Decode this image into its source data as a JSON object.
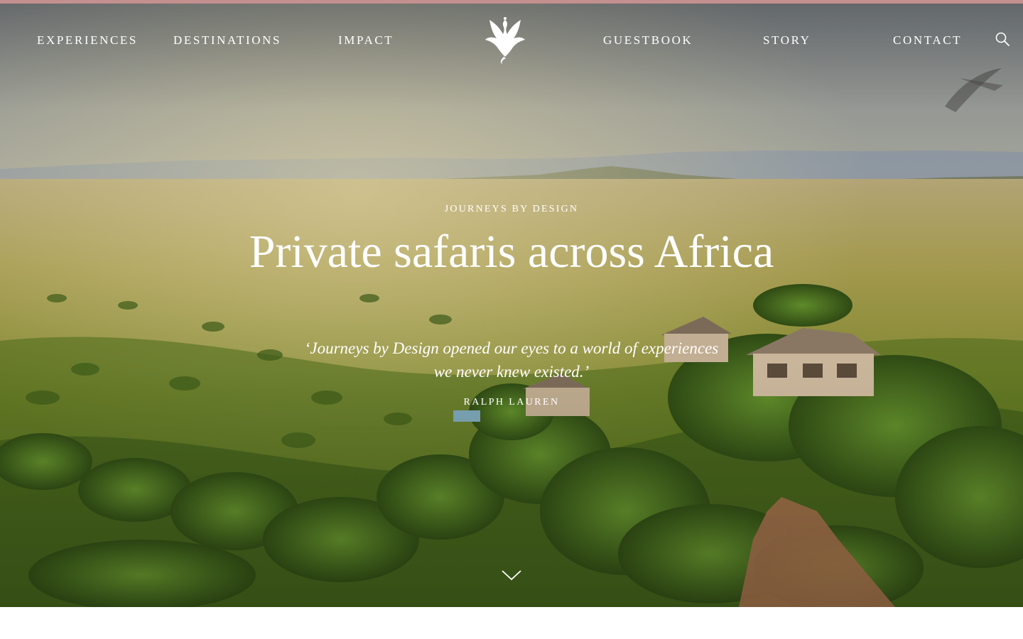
{
  "colors": {
    "top_accent": "#c48f8f",
    "text": "#ffffff"
  },
  "nav": {
    "left_items": [
      {
        "label": "EXPERIENCES"
      },
      {
        "label": "DESTINATIONS"
      },
      {
        "label": "IMPACT"
      }
    ],
    "logo": {
      "icon": "swan-phoenix-logo-icon"
    },
    "right_items": [
      {
        "label": "GUESTBOOK"
      },
      {
        "label": "STORY"
      },
      {
        "label": "CONTACT"
      }
    ],
    "search": {
      "icon": "search-icon"
    }
  },
  "hero": {
    "background": "aerial-savanna-lodge-photo",
    "eyebrow": "JOURNEYS BY DESIGN",
    "title": "Private safaris across Africa",
    "quote": "‘Journeys by Design opened our eyes to a world of experiences we never knew existed.’",
    "quote_author": "RALPH LAUREN",
    "scroll": {
      "icon": "chevron-down-icon"
    }
  }
}
